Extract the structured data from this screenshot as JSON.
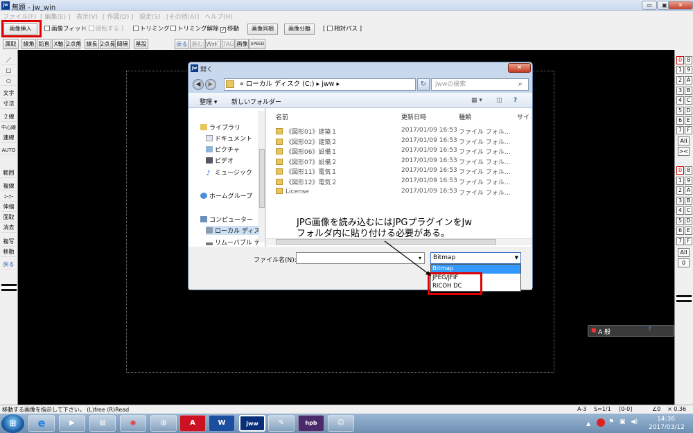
{
  "window": {
    "app_icon": "jw",
    "title": "無題 - jw_win",
    "minimize": "▭",
    "maximize": "▣",
    "close": "✕"
  },
  "menu": [
    "ファイル(F)",
    "[ 編集(E) ]",
    "表示(V)",
    "[ 作図(D) ]",
    "設定(S)",
    "[その他(A)]",
    "ヘルプ(H)"
  ],
  "toolbar1": {
    "insert_image": "画像挿入",
    "fit_image": "画像フィット",
    "rotate": "回転する",
    "trim": "トリミング",
    "untrim": "トリミング解除",
    "move": "移動",
    "same": "画像同梱",
    "split": "画像分離",
    "relpath": "相対パス"
  },
  "toolbar2": [
    "属取",
    "線角",
    "鉛直",
    "X軸",
    "2点角",
    "線長",
    "2点長",
    "間隔",
    "基設",
    "戻る",
    "進む",
    "ｿﾘｯﾄﾞ",
    "TAG",
    "画像",
    "SPEED"
  ],
  "left_panel": [
    "／",
    "□",
    "○",
    "文字",
    "寸法",
    "２線",
    "中心線",
    "連線",
    "AUTO",
    "範囲",
    "複線",
    "ｺｰﾅｰ",
    "伸縮",
    "面取",
    "消去",
    "複写",
    "移動",
    "戻る"
  ],
  "right_panel": {
    "layer_groups_a": [
      [
        "0",
        "8"
      ],
      [
        "1",
        "9"
      ],
      [
        "2",
        "A"
      ],
      [
        "3",
        "B"
      ],
      [
        "4",
        "C"
      ],
      [
        "5",
        "D"
      ],
      [
        "6",
        "E"
      ],
      [
        "7",
        "F"
      ]
    ],
    "all_a": "All",
    "x_a": "><",
    "layer_groups_b": [
      [
        "0",
        "8"
      ],
      [
        "1",
        "9"
      ],
      [
        "2",
        "A"
      ],
      [
        "3",
        "B"
      ],
      [
        "4",
        "C"
      ],
      [
        "5",
        "D"
      ],
      [
        "6",
        "E"
      ],
      [
        "7",
        "F"
      ]
    ],
    "all_b": "All",
    "zero_b": "0"
  },
  "ime_bar": "A 般",
  "dialog": {
    "title": "開く",
    "address": "«  ローカル ディスク (C:)  ▸  jww  ▸",
    "search_placeholder": "jwwの検索",
    "organize": "整理 ▾",
    "new_folder": "新しいフォルダー",
    "nav_items": [
      "ライブラリ",
      "ドキュメント",
      "ピクチャ",
      "ビデオ",
      "ミュージック",
      "ホームグループ",
      "コンピューター",
      "ローカル ディス",
      "リムーバブル デ"
    ],
    "columns": [
      "名前",
      "更新日時",
      "種類",
      "サイ"
    ],
    "files": [
      {
        "name": "《図形01》建築１",
        "date": "2017/01/09 16:53",
        "type": "ファイル フォル..."
      },
      {
        "name": "《図形02》建築２",
        "date": "2017/01/09 16:53",
        "type": "ファイル フォル..."
      },
      {
        "name": "《図形06》設備１",
        "date": "2017/01/09 16:53",
        "type": "ファイル フォル..."
      },
      {
        "name": "《図形07》設備２",
        "date": "2017/01/09 16:53",
        "type": "ファイル フォル..."
      },
      {
        "name": "《図形11》電気１",
        "date": "2017/01/09 16:53",
        "type": "ファイル フォル..."
      },
      {
        "name": "《図形12》電気２",
        "date": "2017/01/09 16:53",
        "type": "ファイル フォル..."
      },
      {
        "name": "License",
        "date": "2017/01/09 16:53",
        "type": "ファイル フォル..."
      }
    ],
    "filename_label": "ファイル名(N):",
    "filename_value": "",
    "filetype_selected": "Bitmap",
    "filetype_options": [
      "Bitmap",
      "JPEG/JFIF",
      "RICOH DC"
    ]
  },
  "annotation": {
    "line1": "JPG画像を読み込むにはJPGプラグインをJw",
    "line2": "フォルダ内に貼り付ける必要がある。"
  },
  "status": {
    "message": "移動する画像を指示して下さい。 (L)free (R)Read",
    "layer": "A-3",
    "scale": "S=1/1",
    "group": "[0-0]",
    "angle": "∠0",
    "factor": "× 0.36"
  },
  "taskbar": {
    "apps": [
      "e",
      "▶",
      "▤",
      "◉",
      "◍",
      "A",
      "W",
      "jww",
      "✎",
      "hpb",
      "☺"
    ],
    "time": "14:36",
    "date": "2017/03/12"
  }
}
